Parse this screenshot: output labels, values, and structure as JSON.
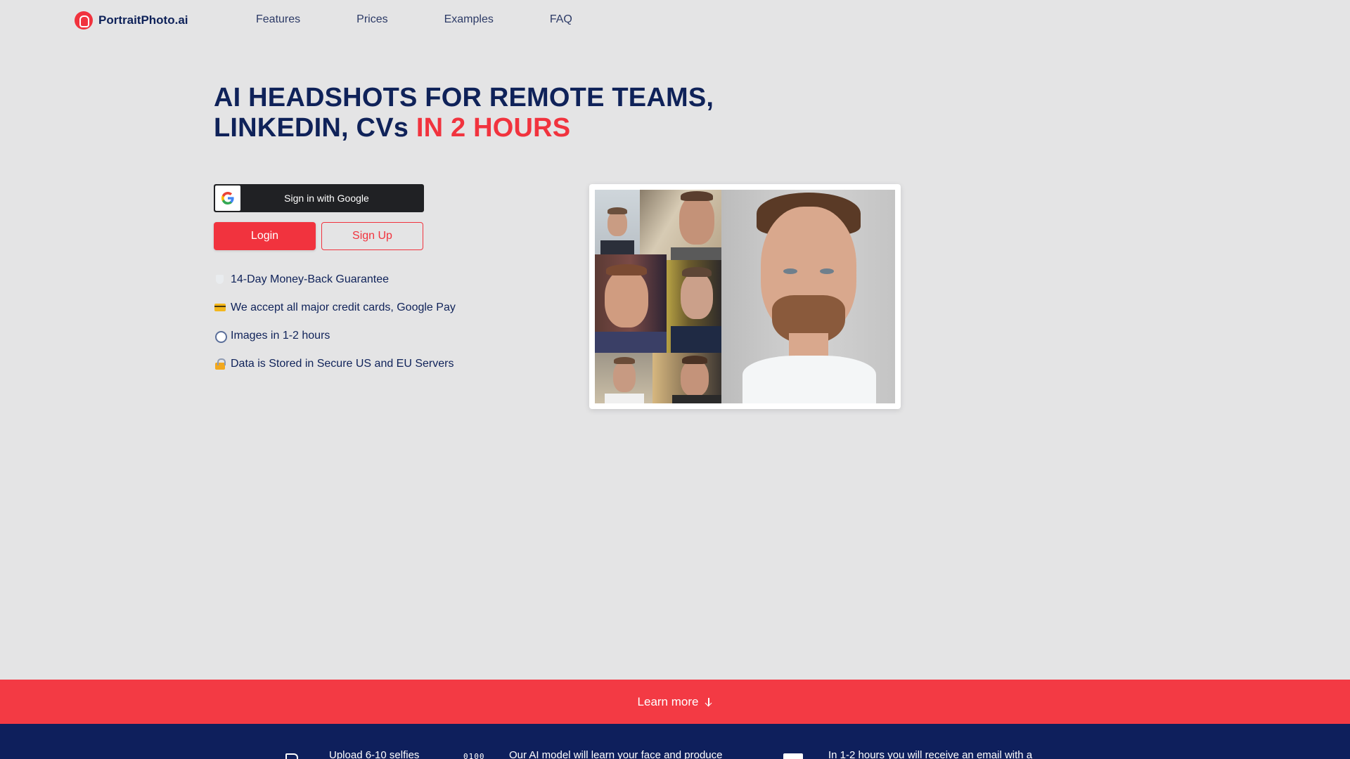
{
  "nav": {
    "logo_text": "PortraitPhoto.ai",
    "links": [
      "Features",
      "Prices",
      "Examples",
      "FAQ"
    ]
  },
  "hero": {
    "title_line1": "AI HEADSHOTS FOR REMOTE TEAMS,",
    "title_line2_prefix": "LINKEDIN, CVs",
    "title_line2_accent": "IN 2 HOURS"
  },
  "auth": {
    "google_label": "Sign in with Google",
    "login_label": "Login",
    "signup_label": "Sign Up"
  },
  "features": [
    {
      "icon": "shield-icon",
      "text": "14-Day Money-Back Guarantee"
    },
    {
      "icon": "credit-card-icon",
      "text": "We accept all major credit cards, Google Pay"
    },
    {
      "icon": "alarm-clock-icon",
      "text": "Images in 1-2 hours"
    },
    {
      "icon": "lock-icon",
      "text": "Data is Stored in Secure US and EU Servers"
    }
  ],
  "learn_more": {
    "label": "Learn more"
  },
  "steps": [
    {
      "icon": "document-icon",
      "text": "Upload 6-10 selfies"
    },
    {
      "icon": "binary-icon",
      "icon_text": "0100",
      "text": "Our AI model will learn your face and produce"
    },
    {
      "icon": "mail-icon",
      "text": "In 1-2 hours you will receive an email with a"
    }
  ],
  "colors": {
    "brand_red": "#f1333e",
    "navy": "#0f2259",
    "page_bg": "#e4e4e5",
    "steps_bg": "#0e1f5c"
  }
}
